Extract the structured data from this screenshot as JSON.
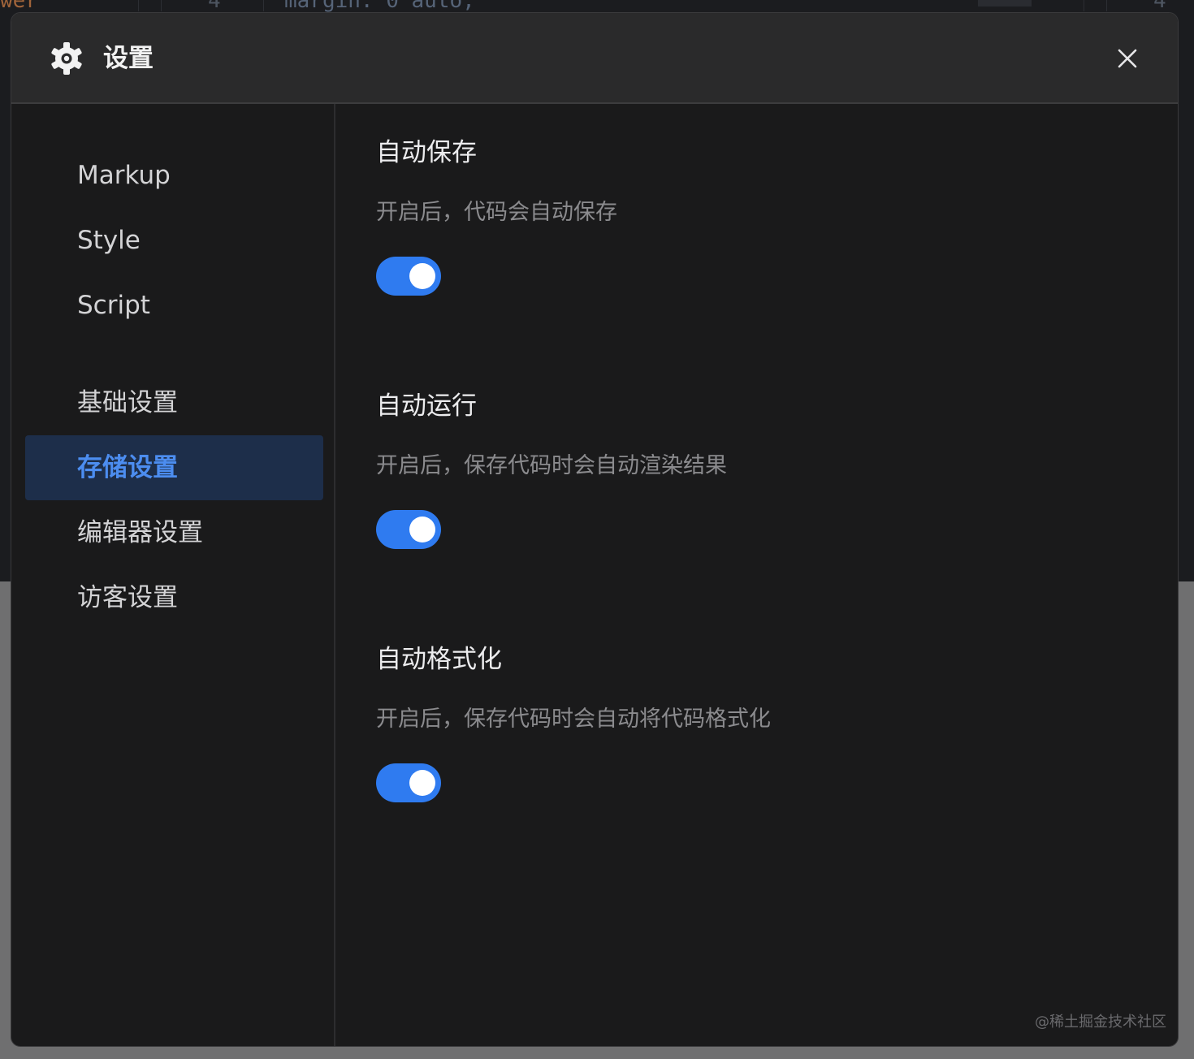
{
  "background": {
    "fragment_left": "wer",
    "line_number": "4",
    "code": "margin: 0 auto;",
    "line_number_right": "4"
  },
  "dialog": {
    "title": "设置",
    "icon": "gear-icon",
    "close_icon": "close-icon"
  },
  "sidebar": {
    "items": [
      {
        "label": "Markup",
        "active": false
      },
      {
        "label": "Style",
        "active": false
      },
      {
        "label": "Script",
        "active": false
      },
      {
        "label": "基础设置",
        "active": false
      },
      {
        "label": "存储设置",
        "active": true
      },
      {
        "label": "编辑器设置",
        "active": false
      },
      {
        "label": "访客设置",
        "active": false
      }
    ]
  },
  "settings": [
    {
      "title": "自动保存",
      "description": "开启后，代码会自动保存",
      "enabled": true
    },
    {
      "title": "自动运行",
      "description": "开启后，保存代码时会自动渲染结果",
      "enabled": true
    },
    {
      "title": "自动格式化",
      "description": "开启后，保存代码时会自动将代码格式化",
      "enabled": true
    }
  ],
  "watermark": "@稀土掘金技术社区",
  "colors": {
    "accent": "#2f7bf0",
    "active_text": "#4c8df0",
    "active_bg": "#1d2e4a",
    "dialog_bg": "#1a1a1b",
    "header_bg": "#2a2a2b"
  }
}
